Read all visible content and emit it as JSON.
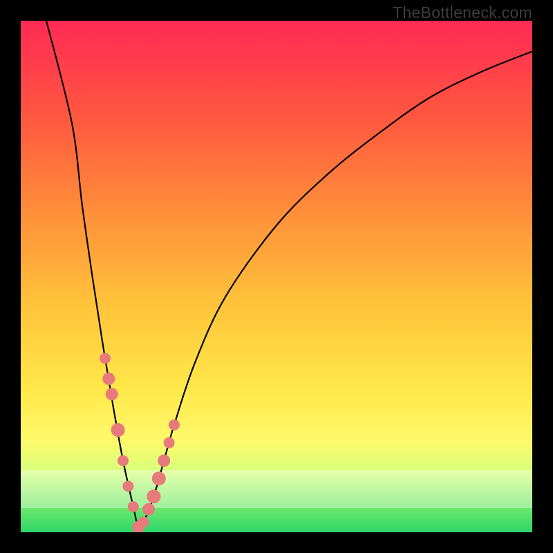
{
  "watermark": "TheBottleneck.com",
  "chart_data": {
    "type": "line",
    "title": "",
    "xlabel": "",
    "ylabel": "",
    "xlim": [
      0,
      100
    ],
    "ylim": [
      0,
      100
    ],
    "note": "Unlabeled V-shaped bottleneck curve. x is an implicit 0–100 component ratio; y is 0 (bottom, green) to 100 (top, red) mismatch magnitude. The curve minimum (≈0) sits near x≈23. Points along the curve near the bottom are highlighted with salmon markers.",
    "series": [
      {
        "name": "curve",
        "x": [
          5,
          10,
          12,
          14,
          16,
          18,
          20,
          22,
          23,
          24,
          26,
          28,
          30,
          34,
          40,
          50,
          60,
          70,
          80,
          90,
          100
        ],
        "y": [
          100,
          80,
          64,
          50,
          37,
          25,
          14,
          5,
          1,
          2,
          7,
          14,
          21,
          33,
          46,
          60,
          70,
          78,
          85,
          90,
          94
        ]
      }
    ],
    "markers": {
      "name": "highlight-points",
      "color": "#e77a7a",
      "x": [
        16.5,
        17.2,
        17.8,
        19.0,
        20.0,
        21.0,
        22.0,
        23.0,
        24.0,
        25.0,
        26.0,
        27.0,
        28.0,
        29.0,
        30.0
      ],
      "y": [
        34.0,
        30.0,
        27.0,
        20.0,
        14.0,
        9.0,
        5.0,
        1.0,
        2.0,
        4.5,
        7.0,
        10.5,
        14.0,
        17.5,
        21.0
      ],
      "r": [
        8,
        9,
        9,
        10,
        8,
        8,
        8,
        9,
        8,
        9,
        10,
        10,
        9,
        8,
        8
      ]
    }
  }
}
